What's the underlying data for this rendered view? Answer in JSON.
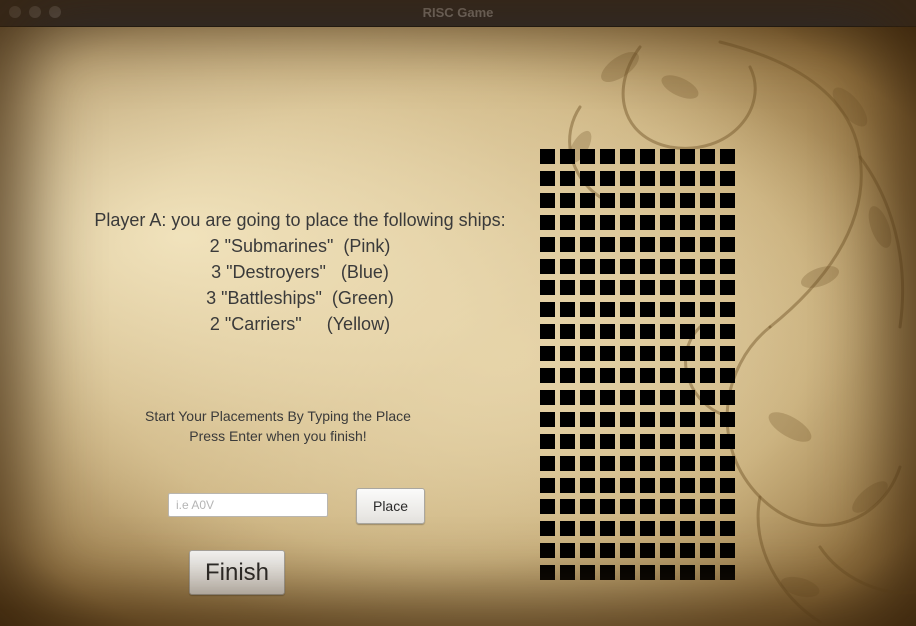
{
  "window": {
    "title": "RISC Game"
  },
  "instructions": {
    "lines": [
      "Player A: you are going to place the following ships:",
      "2 \"Submarines\"  (Pink)",
      "3 \"Destroyers\"   (Blue)",
      "3 \"Battleships\"  (Green)",
      "2 \"Carriers\"     (Yellow)"
    ]
  },
  "hint": {
    "line1": "Start Your Placements By Typing the Place",
    "line2": "Press Enter when you finish!"
  },
  "placement_input": {
    "value": "",
    "placeholder": "i.e A0V"
  },
  "buttons": {
    "place": "Place",
    "finish": "Finish"
  },
  "board": {
    "rows": 20,
    "columns": 10,
    "cell_color": "#000000"
  },
  "colors": {
    "titlebar": "#2b2a2e",
    "parchment": "#d8c293",
    "text": "#3a3a3a"
  }
}
